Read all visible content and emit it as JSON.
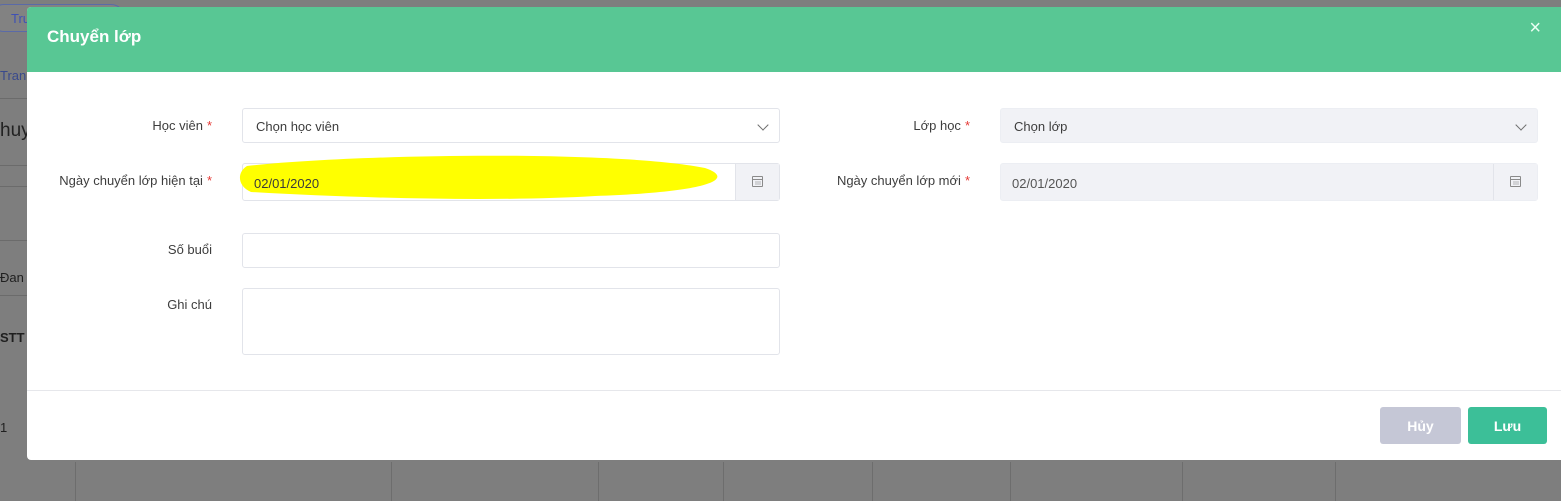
{
  "background": {
    "tab_label": "Trư",
    "link_text": "Tran",
    "heading_text": "huy",
    "filter_text": "Đan",
    "table_header": "STT",
    "row_text": "1"
  },
  "modal": {
    "title": "Chuyển lớp",
    "close_icon": "×",
    "required_mark": "*",
    "fields": {
      "student": {
        "label": "Học viên",
        "placeholder": "Chọn học viên"
      },
      "class": {
        "label": "Lớp học",
        "placeholder": "Chọn lớp"
      },
      "current_date": {
        "label": "Ngày chuyển lớp hiện tại",
        "value": "02/01/2020"
      },
      "new_date": {
        "label": "Ngày chuyển lớp mới",
        "value": "02/01/2020"
      },
      "sessions": {
        "label": "Số buổi",
        "value": ""
      },
      "note": {
        "label": "Ghi chú",
        "value": ""
      }
    },
    "buttons": {
      "cancel": "Hủy",
      "save": "Lưu"
    }
  },
  "colors": {
    "header": "#58c794",
    "save_button": "#3cbf98",
    "cancel_button": "#c5c7d6",
    "highlight": "#ffff00",
    "required": "#e53935"
  }
}
